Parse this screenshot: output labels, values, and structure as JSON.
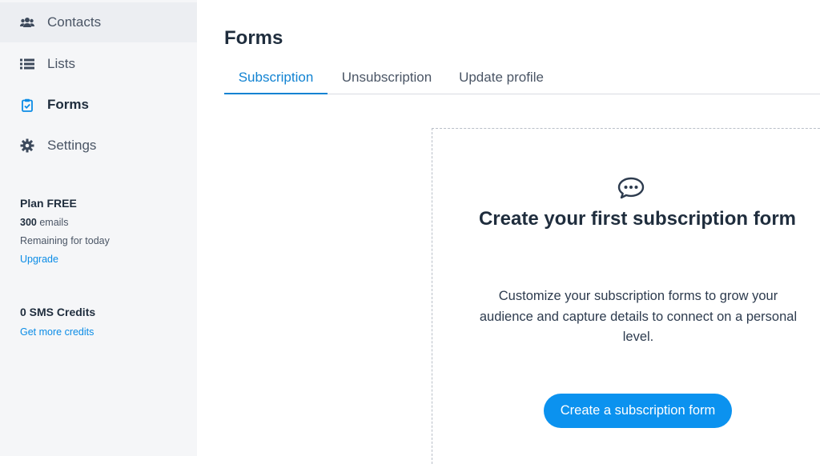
{
  "sidebar": {
    "items": [
      {
        "label": "Contacts",
        "icon": "users-icon"
      },
      {
        "label": "Lists",
        "icon": "list-icon"
      },
      {
        "label": "Forms",
        "icon": "clipboard-check-icon"
      },
      {
        "label": "Settings",
        "icon": "gear-icon"
      }
    ],
    "plan": {
      "title": "Plan FREE",
      "emails_count": "300",
      "emails_unit": "emails",
      "remaining": "Remaining for today",
      "upgrade": "Upgrade"
    },
    "sms": {
      "title": "0 SMS Credits",
      "link": "Get more credits"
    }
  },
  "main": {
    "title": "Forms",
    "tabs": [
      {
        "label": "Subscription"
      },
      {
        "label": "Unsubscription"
      },
      {
        "label": "Update profile"
      }
    ],
    "empty_state": {
      "icon": "chat-bubble-icon",
      "title": "Create your first subscription form",
      "description": "Customize your subscription forms to grow your audience and capture details to connect on a personal level.",
      "cta": "Create a subscription form"
    }
  },
  "colors": {
    "accent": "#1283d2",
    "button": "#0b92ef",
    "sidebar_bg": "#f5f6f8"
  }
}
